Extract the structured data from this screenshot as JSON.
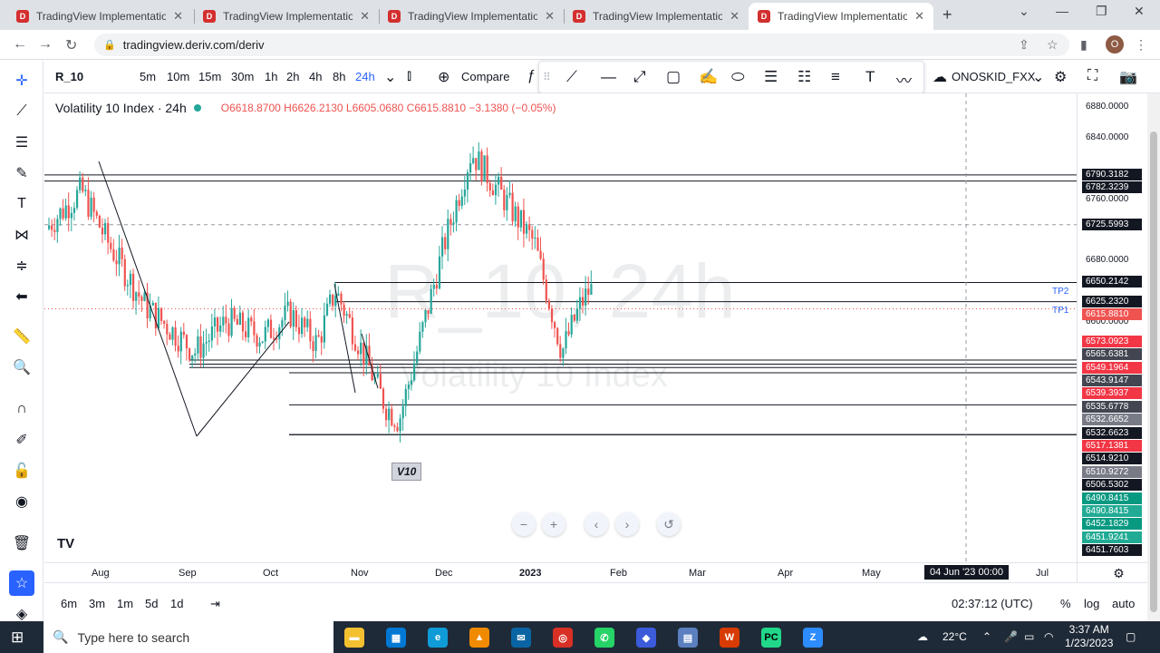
{
  "browser": {
    "tabs": [
      {
        "title": "TradingView Implementation",
        "active": false
      },
      {
        "title": "TradingView Implementation",
        "active": false
      },
      {
        "title": "TradingView Implementation",
        "active": false
      },
      {
        "title": "TradingView Implementation",
        "active": false
      },
      {
        "title": "TradingView Implementation",
        "active": true
      }
    ],
    "url": "tradingview.deriv.com/deriv",
    "profile_initial": "O"
  },
  "toolbar": {
    "symbol": "R_10",
    "timeframes": [
      "5m",
      "10m",
      "15m",
      "30m",
      "1h",
      "2h",
      "4h",
      "8h",
      "24h"
    ],
    "selected_timeframe": "24h",
    "compare_label": "Compare",
    "layout_name": "ONOSKID_FXX"
  },
  "legend": {
    "name": "Volatility 10 Index · 24h",
    "open": "O6618.8700",
    "high": "H6626.2130",
    "low": "L6605.0680",
    "close": "C6615.8810",
    "change": "−3.1380 (−0.05%)"
  },
  "watermark": {
    "main": "R_10, 24h",
    "sub": "Volatility 10 Index"
  },
  "annotations": {
    "tp2": "TP2",
    "tp1": "TP1",
    "label_v10": "V10"
  },
  "price_axis": {
    "ticks": [
      "6880.0000",
      "6840.0000",
      "6760.0000",
      "6680.0000",
      "6600.0000"
    ],
    "labels": [
      {
        "text": "6790.3182",
        "color": "#131722"
      },
      {
        "text": "6782.3239",
        "color": "#131722"
      },
      {
        "text": "6725.5993",
        "color": "#131722"
      },
      {
        "text": "6650.2142",
        "color": "#131722"
      },
      {
        "text": "6625.2320",
        "color": "#131722"
      },
      {
        "text": "6615.8810",
        "color": "#ef5350"
      },
      {
        "text": "6573.0923",
        "color": "#f23645"
      },
      {
        "text": "6565.6381",
        "color": "#434651"
      },
      {
        "text": "6549.1964",
        "color": "#f23645"
      },
      {
        "text": "6543.9147",
        "color": "#434651"
      },
      {
        "text": "6539.3937",
        "color": "#f23645"
      },
      {
        "text": "6535.6778",
        "color": "#434651"
      },
      {
        "text": "6532.6652",
        "color": "#787b86"
      },
      {
        "text": "6532.6623",
        "color": "#131722"
      },
      {
        "text": "6517.1381",
        "color": "#f23645"
      },
      {
        "text": "6514.9210",
        "color": "#131722"
      },
      {
        "text": "6510.9272",
        "color": "#787b86"
      },
      {
        "text": "6506.5302",
        "color": "#131722"
      },
      {
        "text": "6490.8415",
        "color": "#089981"
      },
      {
        "text": "6490.8415",
        "color": "#22ab94"
      },
      {
        "text": "6452.1829",
        "color": "#089981"
      },
      {
        "text": "6451.9241",
        "color": "#22ab94"
      },
      {
        "text": "6451.7603",
        "color": "#131722"
      }
    ]
  },
  "time_axis": {
    "ticks": [
      "Aug",
      "Sep",
      "Oct",
      "Nov",
      "Dec",
      "2023",
      "Feb",
      "Mar",
      "Apr",
      "May",
      "Jul"
    ],
    "crosshair": "04 Jun '23   00:00"
  },
  "bottom": {
    "ranges": [
      "6m",
      "3m",
      "1m",
      "5d",
      "1d"
    ],
    "clock": "02:37:12 (UTC)",
    "pct": "%",
    "log": "log",
    "auto": "auto"
  },
  "taskbar": {
    "search_placeholder": "Type here to search",
    "weather": "22°C",
    "time": "3:37 AM",
    "date": "1/23/2023"
  }
}
